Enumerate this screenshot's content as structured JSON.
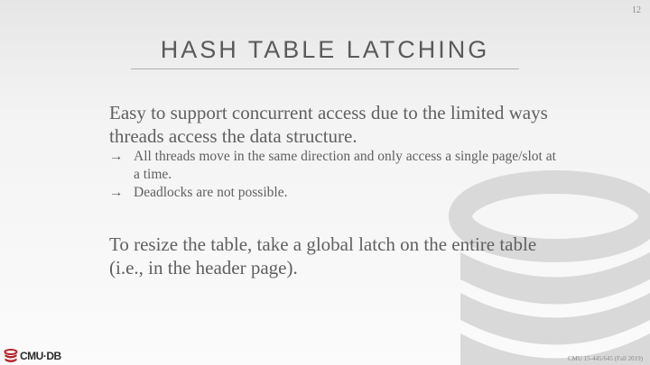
{
  "slide": {
    "page_number": "12",
    "title": "HASH TABLE LATCHING",
    "paragraph1": "Easy to support concurrent access due to the limited ways threads access the data structure.",
    "bullets": [
      "All threads move in the same direction and only access a single page/slot at a time.",
      "Deadlocks are not possible."
    ],
    "arrow_glyph": "→",
    "paragraph2": "To resize the table, take a global latch on the entire table (i.e., in the header page).",
    "logo_text": "CMU·DB",
    "footer": "CMU 15-445/645 (Fall 2019)"
  },
  "colors": {
    "text": "#606060",
    "logo_red": "#b5252b",
    "watermark": "#d9d9d9"
  },
  "icons": {
    "watermark": "database-icon",
    "logo": "database-icon"
  }
}
